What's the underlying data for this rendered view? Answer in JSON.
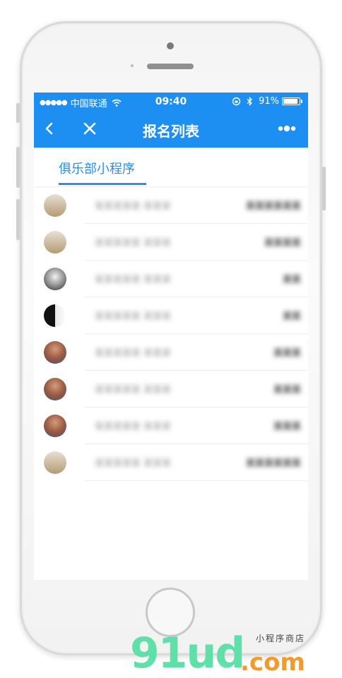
{
  "status_bar": {
    "signal": "●●●●●",
    "carrier": "中国联通",
    "time": "09:40",
    "battery": "91%",
    "battery_level": 0.91
  },
  "navbar": {
    "title": "报名列表",
    "background_color": "#1d8ef2"
  },
  "tabs": [
    {
      "label": "俱乐部小程序",
      "active": true
    }
  ],
  "list": {
    "rows": [
      {
        "avatar": "person-avatar",
        "name": "某某某某某 某某某",
        "status": "某某某某某某"
      },
      {
        "avatar": "person-avatar",
        "name": "某某某某某 某某某",
        "status": "某某某某"
      },
      {
        "avatar": "bw-crowd-avatar",
        "name": "某某某某某 某某某",
        "status": "某某"
      },
      {
        "avatar": "bw-split-avatar",
        "name": "某某某某某 某某某",
        "status": "某某"
      },
      {
        "avatar": "man-avatar",
        "name": "某某某某某 某某某",
        "status": "某某某"
      },
      {
        "avatar": "man-avatar",
        "name": "某某某某某 某某某",
        "status": "某某某"
      },
      {
        "avatar": "man-avatar",
        "name": "某某某某某 某某某",
        "status": "某某某"
      },
      {
        "avatar": "person-avatar",
        "name": "某某某某某 某某某",
        "status": "某某某某某某"
      }
    ]
  },
  "watermark": {
    "brand": "91ud",
    "suffix": ".com",
    "tagline": "小程序商店"
  }
}
